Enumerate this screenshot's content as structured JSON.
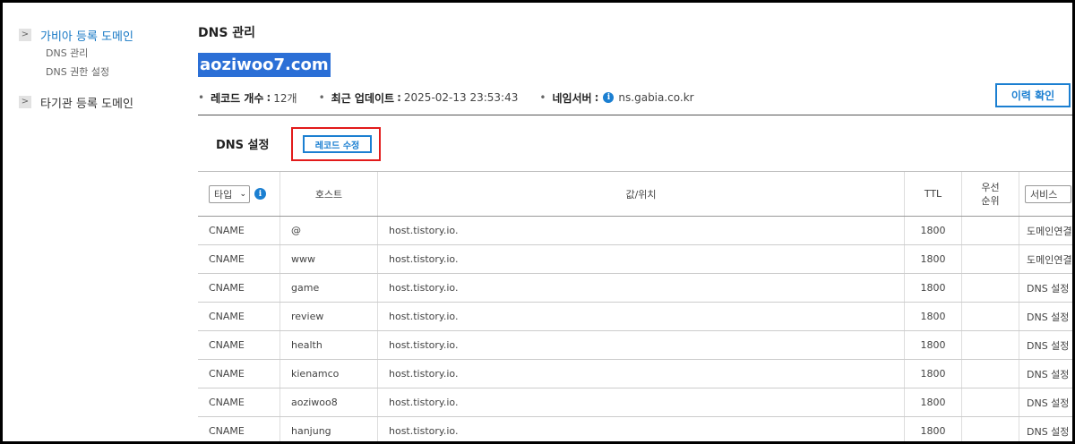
{
  "sidebar": {
    "groups": [
      {
        "toggle": ">",
        "title": "가비아 등록 도메인",
        "items": [
          "DNS 관리",
          "DNS 권한 설정"
        ]
      },
      {
        "toggle": ">",
        "title": "타기관 등록 도메인"
      }
    ]
  },
  "main": {
    "title": "DNS 관리",
    "domain": "aoziwoo7.com",
    "info": {
      "record_count_label": "레코드 개수",
      "record_count_value": "12개",
      "updated_label": "최근 업데이트",
      "updated_value": "2025-02-13 23:53:43",
      "nameserver_label": "네임서버",
      "nameserver_value": "ns.gabia.co.kr",
      "separator": ":",
      "info_glyph": "i"
    },
    "history_button": "이력 확인",
    "dns_settings_title": "DNS 설정",
    "edit_records_button": "레코드 수정"
  },
  "table": {
    "type_select": "타입",
    "type_arrow": "⌄",
    "type_info_glyph": "i",
    "headers": {
      "host": "호스트",
      "value": "값/위치",
      "ttl": "TTL",
      "priority_line1": "우선",
      "priority_line2": "순위",
      "service_select": "서비스"
    },
    "rows": [
      {
        "type": "CNAME",
        "host": "@",
        "value": "host.tistory.io.",
        "ttl": "1800",
        "priority": "",
        "service": "도메인연결"
      },
      {
        "type": "CNAME",
        "host": "www",
        "value": "host.tistory.io.",
        "ttl": "1800",
        "priority": "",
        "service": "도메인연결"
      },
      {
        "type": "CNAME",
        "host": "game",
        "value": "host.tistory.io.",
        "ttl": "1800",
        "priority": "",
        "service": "DNS 설정"
      },
      {
        "type": "CNAME",
        "host": "review",
        "value": "host.tistory.io.",
        "ttl": "1800",
        "priority": "",
        "service": "DNS 설정"
      },
      {
        "type": "CNAME",
        "host": "health",
        "value": "host.tistory.io.",
        "ttl": "1800",
        "priority": "",
        "service": "DNS 설정"
      },
      {
        "type": "CNAME",
        "host": "kienamco",
        "value": "host.tistory.io.",
        "ttl": "1800",
        "priority": "",
        "service": "DNS 설정"
      },
      {
        "type": "CNAME",
        "host": "aoziwoo8",
        "value": "host.tistory.io.",
        "ttl": "1800",
        "priority": "",
        "service": "DNS 설정"
      },
      {
        "type": "CNAME",
        "host": "hanjung",
        "value": "host.tistory.io.",
        "ttl": "1800",
        "priority": "",
        "service": "DNS 설정"
      }
    ]
  },
  "colors": {
    "accent": "#1b7fd1",
    "highlight": "#2b6fd6",
    "annotation_box": "#e21b1b"
  }
}
